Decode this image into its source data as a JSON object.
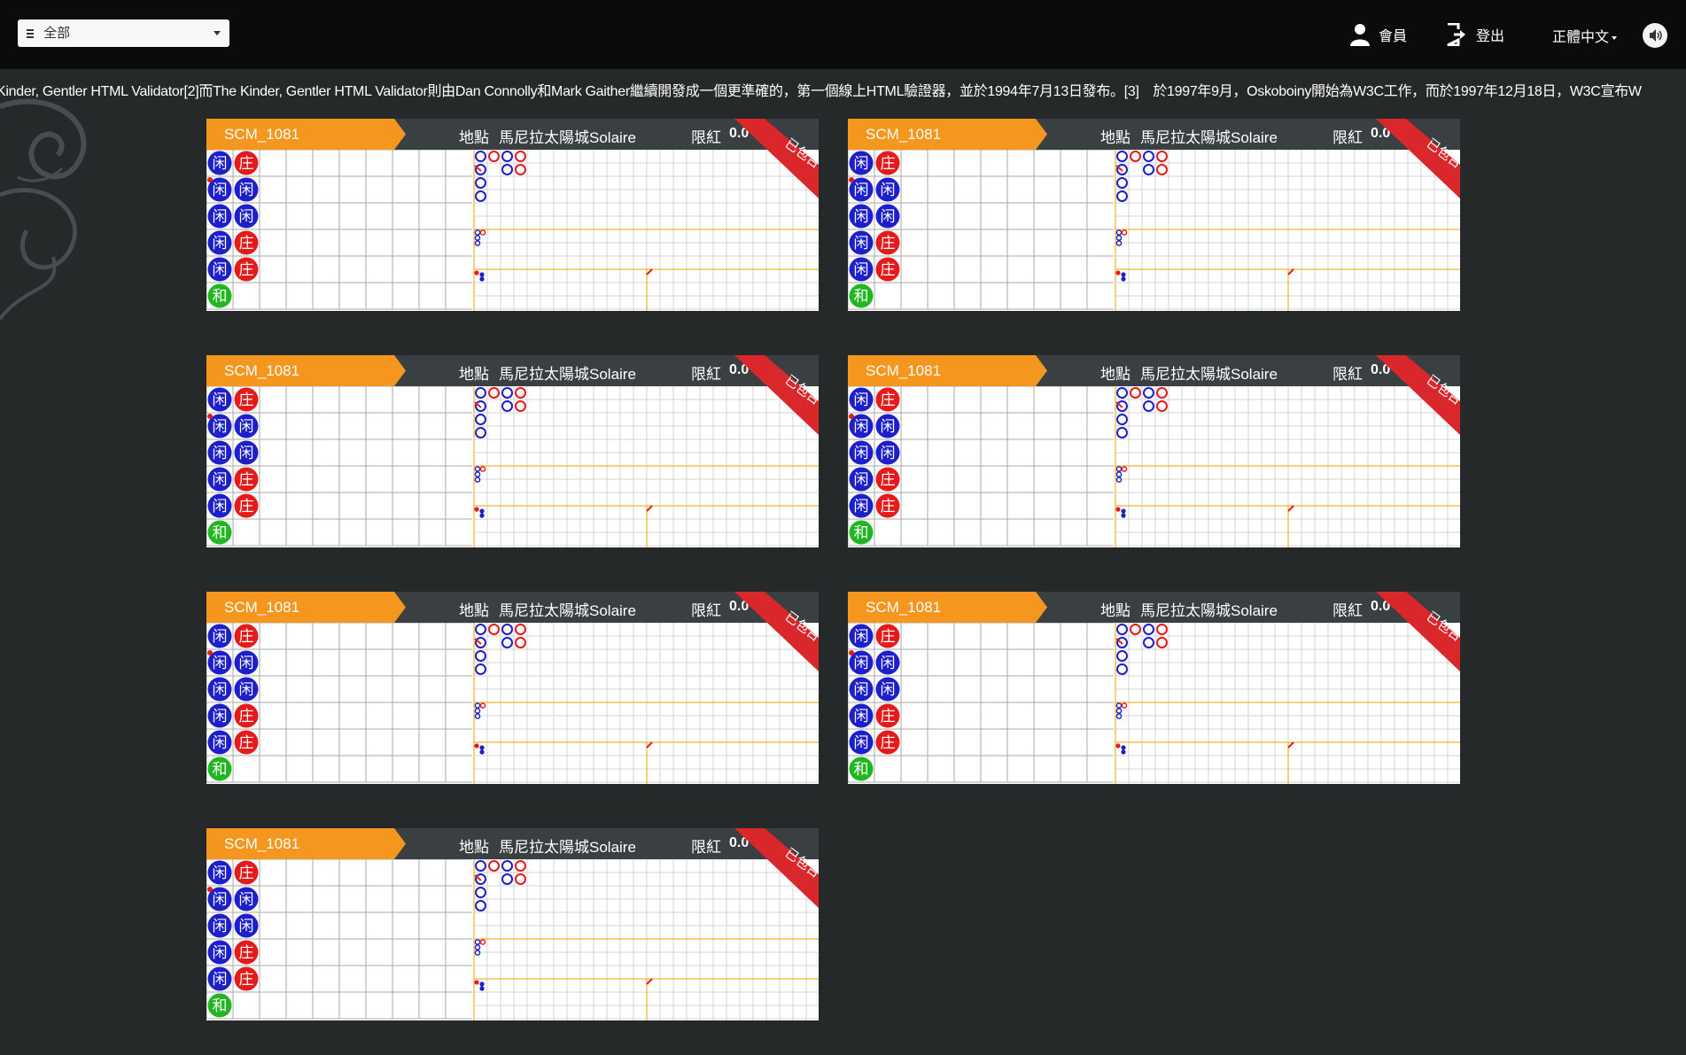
{
  "header": {
    "filter_select": {
      "label": "全部"
    },
    "member_label": "會員",
    "logout_label": "登出",
    "language_label": "正體中文"
  },
  "marquee_text": "Kinder, Gentler HTML Validator[2]而The Kinder, Gentler HTML Validator則由Dan Connolly和Mark Gaither繼續開發成一個更準確的，第一個線上HTML驗證器，並於1994年7月13日發布。[3]　於1997年9月，Oskoboiny開始為W3C工作，而於1997年12月18日，W3C宣布W",
  "tables": [
    {
      "id": "SCM_1081",
      "location_label": "地點",
      "location": "馬尼拉太陽城Solaire",
      "limit_label": "限紅",
      "limit_value": "0.0",
      "ribbon": "已包台"
    },
    {
      "id": "SCM_1081",
      "location_label": "地點",
      "location": "馬尼拉太陽城Solaire",
      "limit_label": "限紅",
      "limit_value": "0.0",
      "ribbon": "已包台"
    },
    {
      "id": "SCM_1081",
      "location_label": "地點",
      "location": "馬尼拉太陽城Solaire",
      "limit_label": "限紅",
      "limit_value": "0.0",
      "ribbon": "已包台"
    },
    {
      "id": "SCM_1081",
      "location_label": "地點",
      "location": "馬尼拉太陽城Solaire",
      "limit_label": "限紅",
      "limit_value": "0.0",
      "ribbon": "已包台"
    },
    {
      "id": "SCM_1081",
      "location_label": "地點",
      "location": "馬尼拉太陽城Solaire",
      "limit_label": "限紅",
      "limit_value": "0.0",
      "ribbon": "已包台"
    },
    {
      "id": "SCM_1081",
      "location_label": "地點",
      "location": "馬尼拉太陽城Solaire",
      "limit_label": "限紅",
      "limit_value": "0.0",
      "ribbon": "已包台"
    },
    {
      "id": "SCM_1081",
      "location_label": "地點",
      "location": "馬尼拉太陽城Solaire",
      "limit_label": "限紅",
      "limit_value": "0.0",
      "ribbon": "已包台"
    }
  ],
  "bead_road": {
    "column_1": [
      "闲",
      "闲",
      "闲",
      "闲",
      "闲",
      "和"
    ],
    "column_2": [
      "庄",
      "闲",
      "闲",
      "庄",
      "庄",
      ""
    ]
  },
  "colors": {
    "player": "#1d1fc9",
    "banker": "#e41b1b",
    "tie": "#22b622",
    "tab": "#f5961e",
    "ribbon": "#d9272b"
  }
}
